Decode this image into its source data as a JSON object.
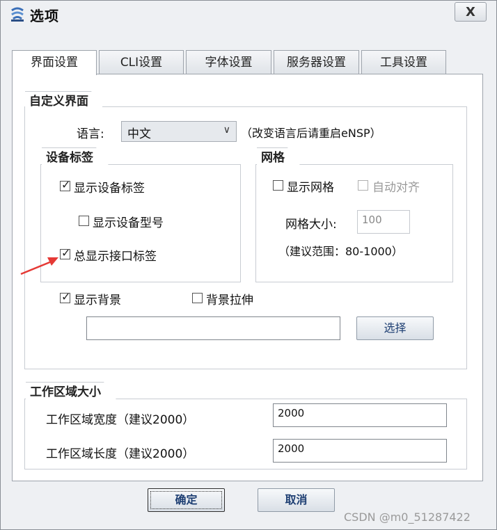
{
  "window": {
    "title": "选项",
    "close_label": "X"
  },
  "tabs": [
    {
      "label": "界面设置",
      "active": true
    },
    {
      "label": "CLI设置",
      "active": false
    },
    {
      "label": "字体设置",
      "active": false
    },
    {
      "label": "服务器设置",
      "active": false
    },
    {
      "label": "工具设置",
      "active": false
    }
  ],
  "custom_ui": {
    "title": "自定义界面",
    "language_label": "语言:",
    "language_value": "中文",
    "language_note": "（改变语言后请重启eNSP）",
    "device_tags": {
      "title": "设备标签",
      "show_device_tags": {
        "label": "显示设备标签",
        "checked": true
      },
      "show_device_model": {
        "label": "显示设备型号",
        "checked": false
      },
      "always_show_interface_tags": {
        "label": "总显示接口标签",
        "checked": true
      }
    },
    "grid": {
      "title": "网格",
      "show_grid": {
        "label": "显示网格",
        "checked": false
      },
      "auto_align": {
        "label": "自动对齐",
        "checked": false,
        "disabled": true
      },
      "grid_size_label": "网格大小:",
      "grid_size_value": "100",
      "range_note": "（建议范围：80-1000）"
    },
    "show_background": {
      "label": "显示背景",
      "checked": true
    },
    "stretch_background": {
      "label": "背景拉伸",
      "checked": false
    },
    "background_path": "",
    "choose_label": "选择"
  },
  "work_area": {
    "title": "工作区域大小",
    "width_label": "工作区域宽度（建议2000）",
    "width_value": "2000",
    "length_label": "工作区域长度（建议2000）",
    "length_value": "2000"
  },
  "buttons": {
    "ok_label": "确定",
    "cancel_label": "取消"
  },
  "watermark": "CSDN @m0_51287422",
  "colors": {
    "annotation_arrow": "#e53935",
    "button_text": "#1e3f73"
  }
}
